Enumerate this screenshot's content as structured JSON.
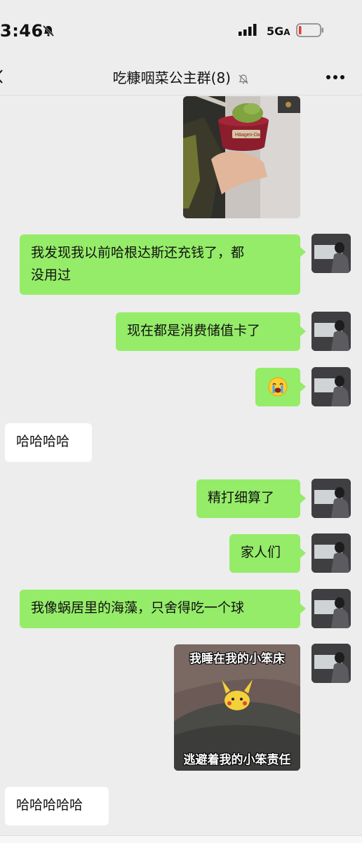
{
  "status": {
    "time": "3:46",
    "network": "5G",
    "network_suffix": "A"
  },
  "chat": {
    "title": "吃糠咽菜公主群(8)"
  },
  "images": {
    "sticker_top_caption": "我睡在我的小笨床",
    "sticker_bottom_caption": "逃避着我的小笨责任",
    "cup_brand": "Häagen-Dazs"
  },
  "messages": [
    {
      "side": "right",
      "text": "我发现我以前哈根达斯还充钱了，都没用过",
      "line1": "我发现我以前哈根达斯还充钱了，都",
      "line2": "没用过"
    },
    {
      "side": "right",
      "text": "现在都是消费储值卡了"
    },
    {
      "side": "right",
      "text": "😭"
    },
    {
      "side": "left",
      "text": "哈哈哈哈"
    },
    {
      "side": "right",
      "text": "精打细算了"
    },
    {
      "side": "right",
      "text": "家人们"
    },
    {
      "side": "right",
      "text": "我像蜗居里的海藻，只舍得吃一个球"
    },
    {
      "side": "left",
      "text": "哈哈哈哈哈"
    }
  ],
  "colors": {
    "background": "#ededed",
    "outgoing_bubble": "#95ec69",
    "incoming_bubble": "#ffffff",
    "battery_low": "#e53935"
  }
}
